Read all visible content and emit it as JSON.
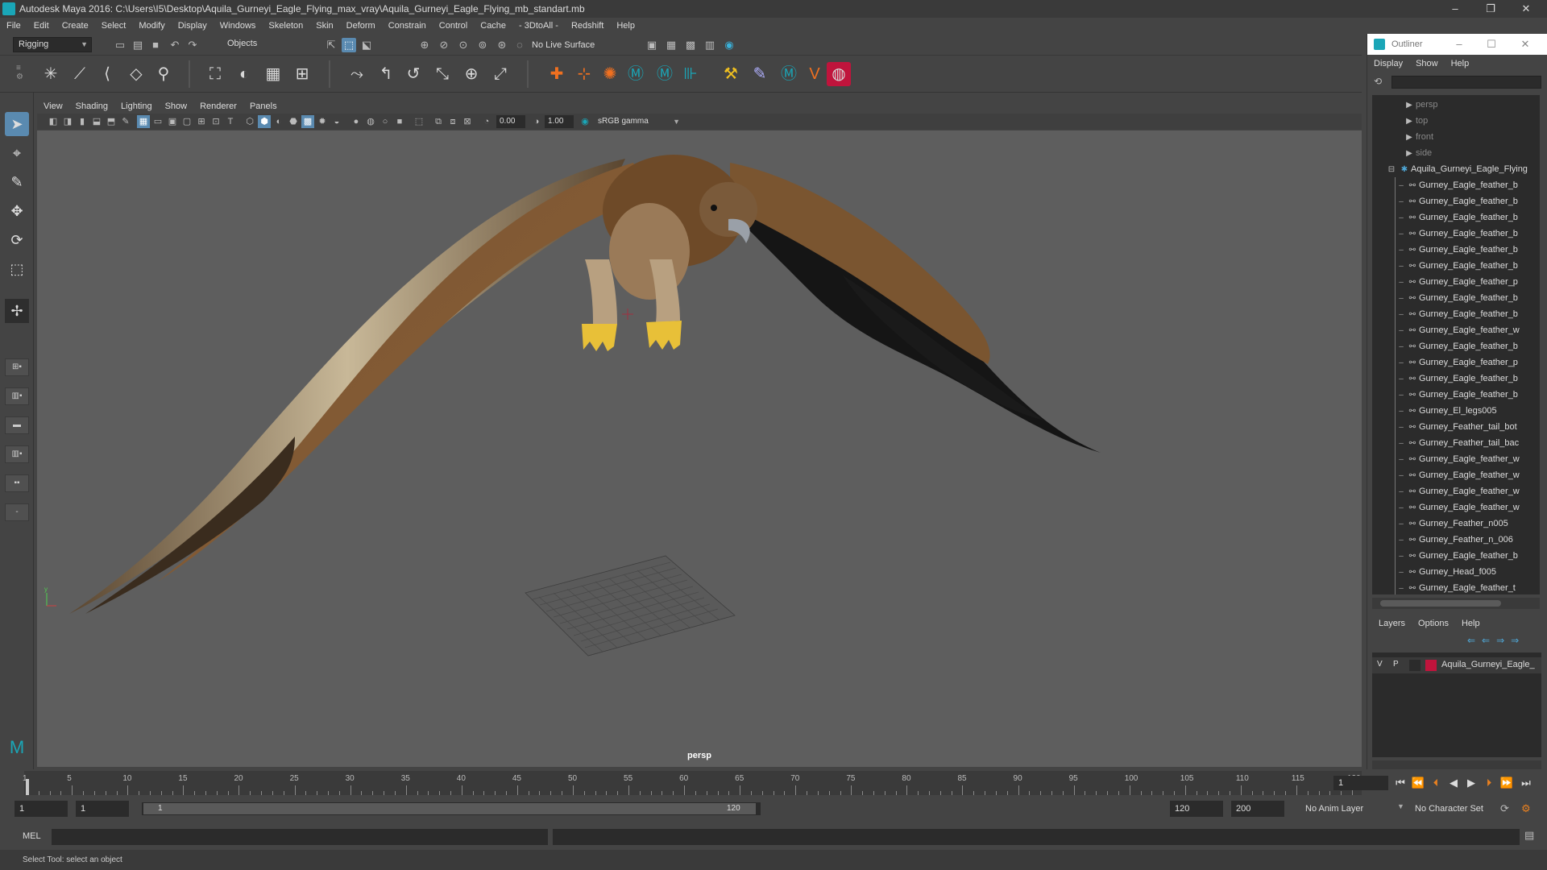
{
  "window": {
    "title": "Autodesk Maya 2016: C:\\Users\\I5\\Desktop\\Aquila_Gurneyi_Eagle_Flying_max_vray\\Aquila_Gurneyi_Eagle_Flying_mb_standart.mb",
    "minimize": "–",
    "maximize": "❐",
    "close": "✕"
  },
  "menubar": {
    "items": [
      "File",
      "Edit",
      "Create",
      "Select",
      "Modify",
      "Display",
      "Windows",
      "Skeleton",
      "Skin",
      "Deform",
      "Constrain",
      "Control",
      "Cache",
      "- 3DtoAll -",
      "Redshift",
      "Help"
    ]
  },
  "statusline": {
    "mode": "Rigging",
    "selection_mode": "Objects",
    "live_surface": "No Live Surface"
  },
  "viewport": {
    "menu": [
      "View",
      "Shading",
      "Lighting",
      "Show",
      "Renderer",
      "Panels"
    ],
    "exposure": "0.00",
    "gamma": "1.00",
    "color_space": "sRGB gamma",
    "camera": "persp"
  },
  "outliner": {
    "title": "Outliner",
    "menu": [
      "Display",
      "Show",
      "Help"
    ],
    "cameras": [
      "persp",
      "top",
      "front",
      "side"
    ],
    "root": "Aquila_Gurneyi_Eagle_Flying",
    "children": [
      "Gurney_Eagle_feather_b",
      "Gurney_Eagle_feather_b",
      "Gurney_Eagle_feather_b",
      "Gurney_Eagle_feather_b",
      "Gurney_Eagle_feather_b",
      "Gurney_Eagle_feather_b",
      "Gurney_Eagle_feather_p",
      "Gurney_Eagle_feather_b",
      "Gurney_Eagle_feather_b",
      "Gurney_Eagle_feather_w",
      "Gurney_Eagle_feather_b",
      "Gurney_Eagle_feather_p",
      "Gurney_Eagle_feather_b",
      "Gurney_Eagle_feather_b",
      "Gurney_El_legs005",
      "Gurney_Feather_tail_bot",
      "Gurney_Feather_tail_bac",
      "Gurney_Eagle_feather_w",
      "Gurney_Eagle_feather_w",
      "Gurney_Eagle_feather_w",
      "Gurney_Eagle_feather_w",
      "Gurney_Feather_n005",
      "Gurney_Feather_n_006",
      "Gurney_Eagle_feather_b",
      "Gurney_Head_f005",
      "Gurney_Eagle_feather_t"
    ]
  },
  "layers": {
    "menu": [
      "Layers",
      "Options",
      "Help"
    ],
    "visible": "V",
    "playback": "P",
    "layer_name": "Aquila_Gurneyi_Eagle_",
    "layer_color": "#c0143c"
  },
  "timeline": {
    "ticks": [
      1,
      5,
      10,
      15,
      20,
      25,
      30,
      35,
      40,
      45,
      50,
      55,
      60,
      65,
      70,
      75,
      80,
      85,
      90,
      95,
      100,
      105,
      110,
      115,
      120
    ],
    "current_frame": "1"
  },
  "range": {
    "start": "1",
    "playback_start": "1",
    "slider_start": "1",
    "slider_end": "120",
    "playback_end": "120",
    "end": "200",
    "anim_layer": "No Anim Layer",
    "character_set": "No Character Set"
  },
  "commandline": {
    "label": "MEL"
  },
  "help": {
    "text": "Select Tool: select an object"
  },
  "colors": {
    "accent": "#5a8ab0",
    "maya_teal": "#1aa6b7"
  }
}
